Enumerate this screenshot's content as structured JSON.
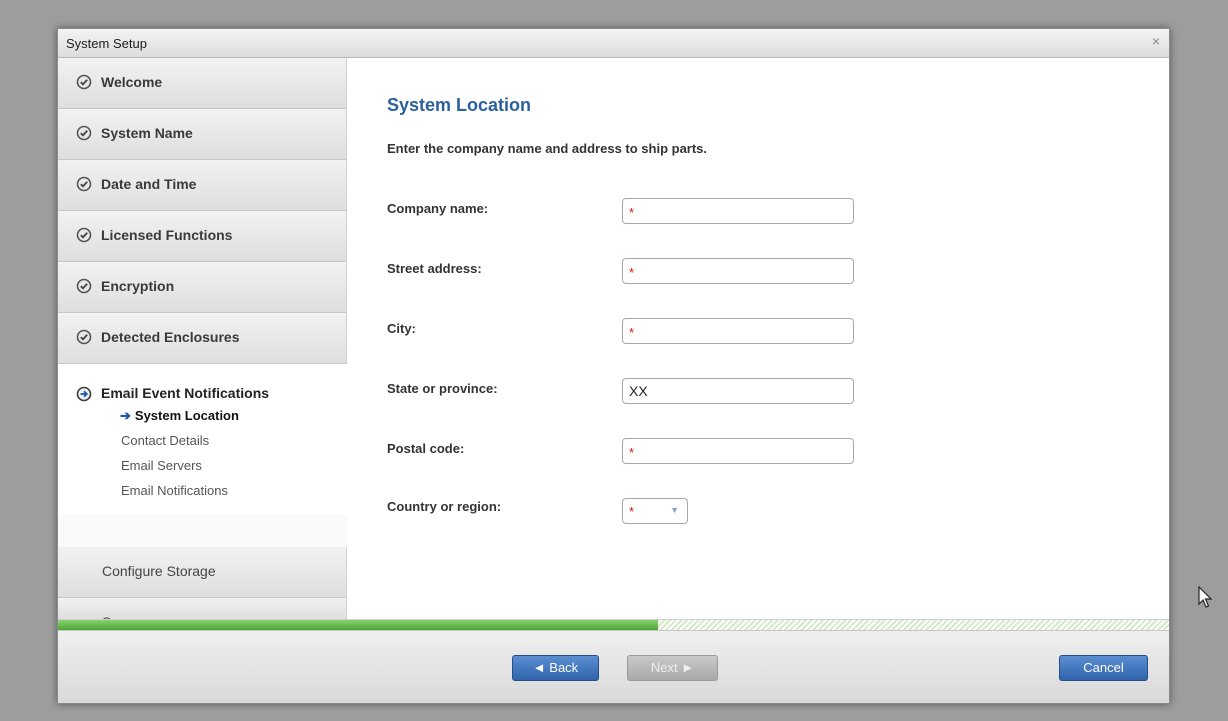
{
  "window": {
    "title": "System Setup",
    "close_symbol": "×"
  },
  "sidebar": {
    "completed_steps": [
      {
        "label": "Welcome",
        "icon": "check-circle-icon"
      },
      {
        "label": "System Name",
        "icon": "check-circle-icon"
      },
      {
        "label": "Date and Time",
        "icon": "check-circle-icon"
      },
      {
        "label": "Licensed Functions",
        "icon": "check-circle-icon"
      },
      {
        "label": "Encryption",
        "icon": "check-circle-icon"
      },
      {
        "label": "Detected Enclosures",
        "icon": "check-circle-icon"
      }
    ],
    "active_step": {
      "label": "Email Event Notifications",
      "icon": "arrow-circle-icon",
      "substeps": [
        {
          "label": "System Location",
          "current": true
        },
        {
          "label": "Contact Details",
          "current": false
        },
        {
          "label": "Email Servers",
          "current": false
        },
        {
          "label": "Email Notifications",
          "current": false
        }
      ]
    },
    "pending_steps": [
      {
        "label": "Configure Storage"
      },
      {
        "label": "Summary"
      }
    ]
  },
  "content": {
    "title": "System Location",
    "description": "Enter the company name and address to ship parts.",
    "required_marker": "*",
    "fields": {
      "company_name": {
        "label": "Company name:",
        "value": ""
      },
      "street_address": {
        "label": "Street address:",
        "value": ""
      },
      "city": {
        "label": "City:",
        "value": ""
      },
      "state": {
        "label": "State or province:",
        "value": "XX"
      },
      "postal_code": {
        "label": "Postal code:",
        "value": ""
      },
      "country": {
        "label": "Country or region:",
        "value": ""
      }
    }
  },
  "progress": {
    "fraction": 0.54
  },
  "footer": {
    "back_label": "◄ Back",
    "next_label": "Next ►",
    "cancel_label": "Cancel"
  },
  "colors": {
    "accent": "#2c5f9e",
    "progress_green": "#4aa832",
    "required_red": "#e01010"
  }
}
